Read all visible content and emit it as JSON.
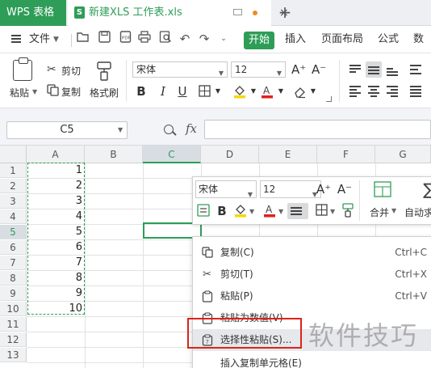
{
  "titlebar": {
    "app_tab": "WPS 表格",
    "doc_tab": "新建XLS 工作表.xls",
    "doc_icon_letter": "S",
    "close_glyph": "×",
    "new_tab_glyph": "+"
  },
  "menubar": {
    "file_label": "文件",
    "items": [
      "开始",
      "插入",
      "页面布局",
      "公式",
      "数据"
    ]
  },
  "ribbon": {
    "paste_label": "粘贴",
    "cut_label": "剪切",
    "copy_label": "复制",
    "format_painter_label": "格式刷",
    "font_name": "宋体",
    "font_size": "12",
    "grow_glyph": "A⁺",
    "shrink_glyph": "A⁻",
    "bold_glyph": "B",
    "italic_glyph": "I",
    "underline_glyph": "U"
  },
  "formula_bar": {
    "name_box": "C5",
    "fx_label": "fx",
    "formula_value": ""
  },
  "sheet": {
    "columns": [
      "A",
      "B",
      "C",
      "D",
      "E",
      "F",
      "G"
    ],
    "active_column": "C",
    "rows": [
      "1",
      "2",
      "3",
      "4",
      "5",
      "6",
      "7",
      "8",
      "9",
      "10",
      "11",
      "12",
      "13"
    ],
    "active_row": "5",
    "column_a_values": [
      "1",
      "2",
      "3",
      "4",
      "5",
      "6",
      "7",
      "8",
      "9",
      "10"
    ]
  },
  "mini_toolbar": {
    "font_name": "宋体",
    "font_size": "12",
    "merge_label": "合并",
    "autosum_label": "自动求"
  },
  "context_menu": {
    "items": [
      {
        "label": "复制(C)",
        "shortcut": "Ctrl+C",
        "icon": "copy-icon"
      },
      {
        "label": "剪切(T)",
        "shortcut": "Ctrl+X",
        "icon": "scissors-icon"
      },
      {
        "label": "粘贴(P)",
        "shortcut": "Ctrl+V",
        "icon": "paste-icon"
      },
      {
        "label": "粘贴为数值(V)",
        "shortcut": "",
        "icon": "paste-values-icon"
      },
      {
        "label": "选择性粘贴(S)...",
        "shortcut": "",
        "icon": "paste-special-icon"
      },
      {
        "label": "插入复制单元格(E)",
        "shortcut": "",
        "icon": ""
      }
    ],
    "highlighted_index": 4
  },
  "watermark": "软件技巧",
  "colors": {
    "accent": "#2e9d57",
    "highlight_box": "#d9241b"
  }
}
